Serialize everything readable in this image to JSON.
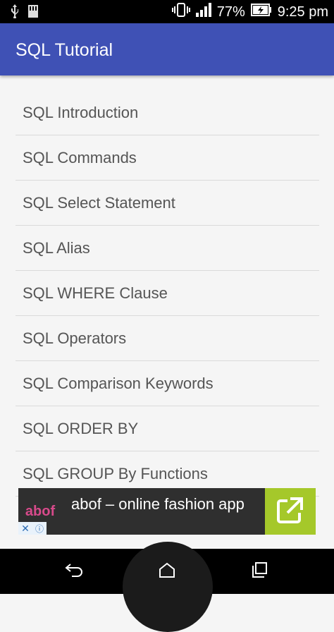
{
  "status_bar": {
    "battery": "77%",
    "time": "9:25 pm",
    "icons": [
      "usb-icon",
      "storage-icon",
      "vibrate-icon",
      "signal-icon",
      "battery-charging-icon"
    ]
  },
  "app_bar": {
    "title": "SQL Tutorial"
  },
  "list": {
    "items": [
      {
        "label": "SQL Introduction"
      },
      {
        "label": "SQL Commands"
      },
      {
        "label": "SQL Select Statement"
      },
      {
        "label": "SQL Alias"
      },
      {
        "label": "SQL WHERE Clause"
      },
      {
        "label": "SQL Operators"
      },
      {
        "label": "SQL Comparison Keywords"
      },
      {
        "label": "SQL ORDER BY"
      },
      {
        "label": "SQL GROUP By Functions"
      }
    ]
  },
  "ad": {
    "logo": "abof",
    "text": "abof – online fashion app",
    "action_icon": "open-external-icon",
    "close_icon": "close-icon",
    "info_icon": "info-icon"
  },
  "nav_bar": {
    "back_icon": "back-icon",
    "home_icon": "home-icon",
    "recents_icon": "recents-icon"
  },
  "colors": {
    "app_bar": "#3f51b5",
    "ad_action": "#a5c82a",
    "background": "#f5f5f5"
  }
}
